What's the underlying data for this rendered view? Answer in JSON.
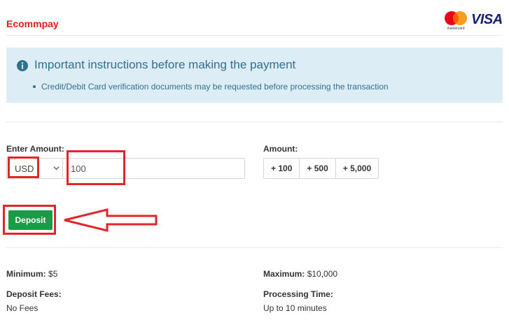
{
  "header": {
    "brand": "Ecommpay",
    "mastercard_caption": "mastercard",
    "visa_label": "VISA",
    "colors": {
      "brand_red": "#e0201b",
      "visa_blue": "#1a1f71"
    }
  },
  "notice": {
    "icon": "info-icon",
    "title": "Important instructions before making the payment",
    "bullets": [
      "Credit/Debit Card verification documents may be requested before processing the transaction"
    ],
    "colors": {
      "background": "#dcedf5",
      "text": "#31708f"
    }
  },
  "form": {
    "enter_amount_label": "Enter Amount:",
    "currency": "USD",
    "amount_value": "100",
    "quick_label": "Amount:",
    "quick_amounts": [
      "+ 100",
      "+ 500",
      "+ 5,000"
    ],
    "deposit_label": "Deposit",
    "deposit_color": "#1a9b46"
  },
  "limits": {
    "minimum_label": "Minimum:",
    "minimum_value": "$5",
    "maximum_label": "Maximum:",
    "maximum_value": "$10,000",
    "fees_label": "Deposit Fees:",
    "fees_value": "No Fees",
    "processing_label": "Processing Time:",
    "processing_value": "Up to 10 minutes"
  },
  "annotations": {
    "highlight_color": "#e3242b"
  }
}
